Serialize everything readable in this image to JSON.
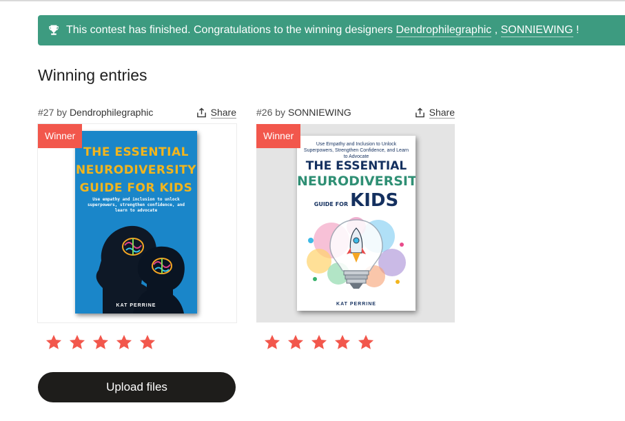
{
  "banner": {
    "icon": "trophy-icon",
    "text": "This contest has finished. Congratulations to the winning designers",
    "winner1": "Dendrophilegraphic",
    "separator": " , ",
    "winner2": "SONNIEWING",
    "end": " !"
  },
  "section_title": "Winning entries",
  "entries": [
    {
      "number": "#27",
      "by": "by",
      "designer": "Dendrophilegraphic",
      "share_label": "Share",
      "badge": "Winner",
      "rating": 5,
      "cover": {
        "title_lines": [
          "THE ESSENTIAL",
          "NEURODIVERSITY",
          "GUIDE FOR KIDS"
        ],
        "subtitle": "Use empathy and inclusion to unlock superpowers, strengthen confidence, and learn to advocate",
        "author": "KAT PERRINE"
      }
    },
    {
      "number": "#26",
      "by": "by",
      "designer": "SONNIEWING",
      "share_label": "Share",
      "badge": "Winner",
      "rating": 5,
      "cover": {
        "subtitle": "Use Empathy and Inclusion to Unlock Superpowers, Strengthen Confidence, and Learn to Advocate",
        "title_line1": "THE ESSENTIAL",
        "title_line2": "NEURODIVERSITY",
        "title_small": "GUIDE FOR",
        "title_big": "KIDS",
        "author": "KAT PERRINE"
      }
    }
  ],
  "upload_label": "Upload files",
  "colors": {
    "banner": "#3d9b80",
    "badge": "#f2574c",
    "star": "#f2574c",
    "button": "#1e1d1b"
  }
}
